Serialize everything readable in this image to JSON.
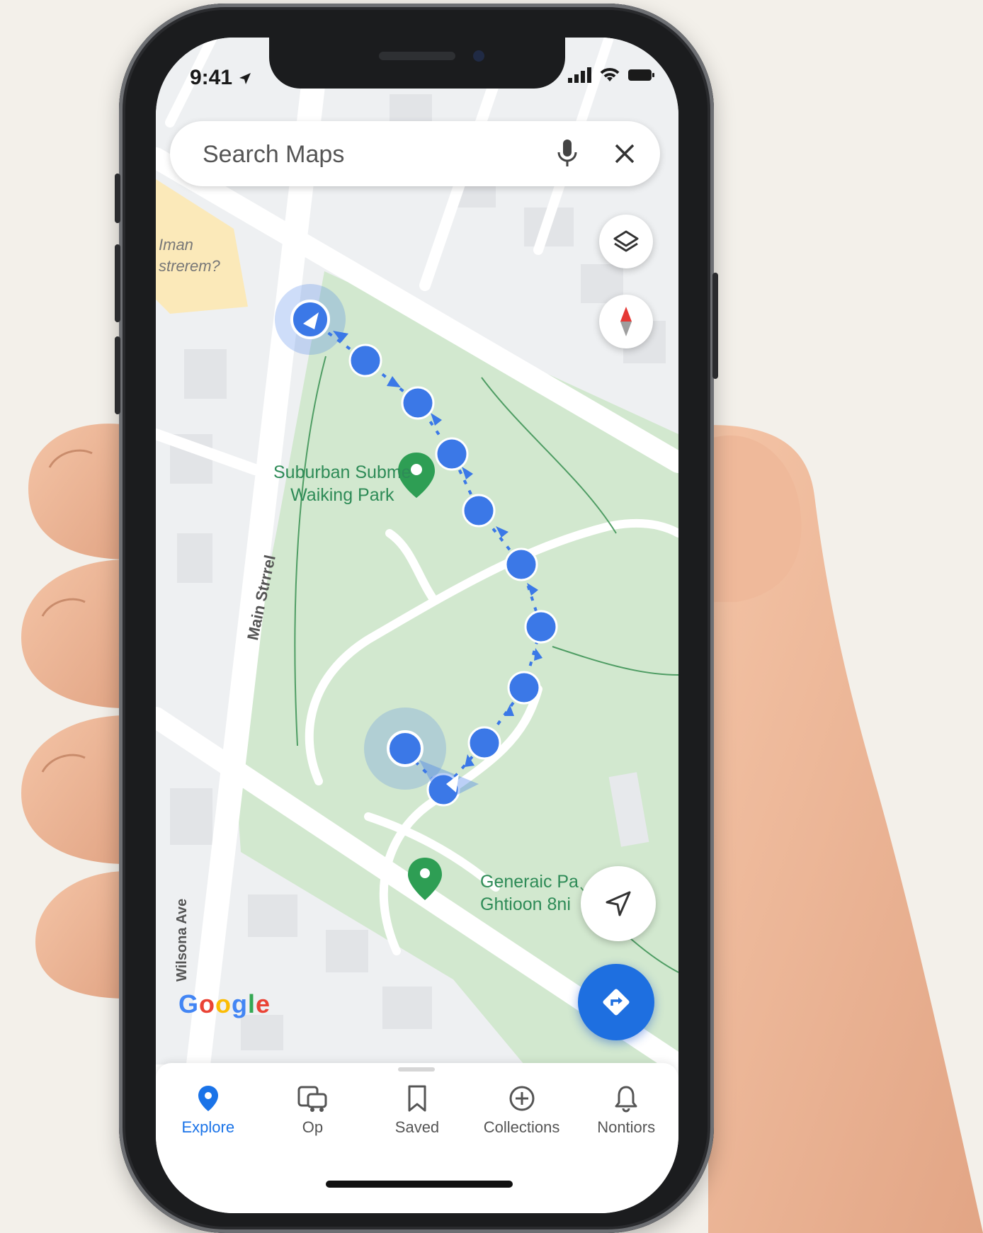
{
  "status_bar": {
    "time": "9:41"
  },
  "search": {
    "placeholder": "Search Maps"
  },
  "map": {
    "poi_label_lines": [
      "Iman",
      "strerem?"
    ],
    "park_label_1_lines": [
      "Suburban Subme",
      "Waiking Park"
    ],
    "park_label_2_lines": [
      "Generaic Pa",
      "Ghtioon 8ni"
    ],
    "street_label": "Main Strrrel",
    "avenue_label": "Wilsona Ave",
    "google_logo": "Google"
  },
  "nav": [
    {
      "label": "Explore",
      "icon": "location-pin-icon",
      "active": true
    },
    {
      "label": "Op",
      "icon": "commute-icon",
      "active": false
    },
    {
      "label": "Saved",
      "icon": "bookmark-icon",
      "active": false
    },
    {
      "label": "Collections",
      "icon": "add-circle-icon",
      "active": false
    },
    {
      "label": "Nontiors",
      "icon": "bell-icon",
      "active": false
    }
  ],
  "colors": {
    "route_blue": "#3b78e7",
    "park_green": "#d2e8cf",
    "label_green": "#2e8b57",
    "accent_blue": "#1a73e8"
  }
}
